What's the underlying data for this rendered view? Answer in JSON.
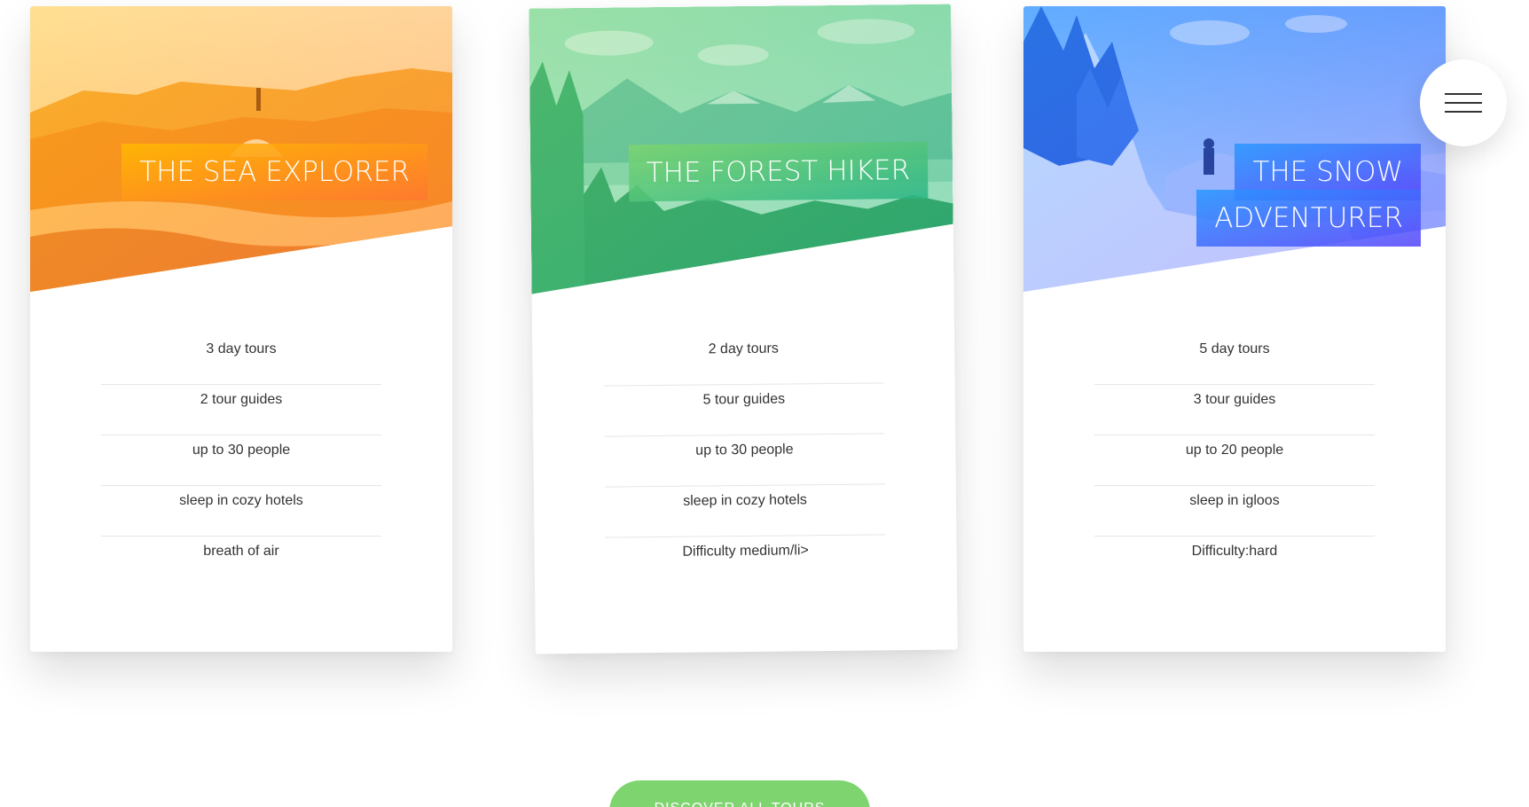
{
  "menu": {
    "icon": "hamburger-icon"
  },
  "cards": [
    {
      "title": "THE SEA EXPLORER",
      "theme_colors": [
        "#ffb900",
        "#ff7730"
      ],
      "image": "rocky-coast-photo",
      "features": [
        "3 day tours",
        "2 tour guides",
        "up to 30 people",
        "sleep in cozy hotels",
        "breath of air"
      ]
    },
    {
      "title": "THE FOREST HIKER",
      "theme_colors": [
        "#7ed56f",
        "#28b485"
      ],
      "image": "forest-mountains-photo",
      "features": [
        "2 day tours",
        "5 tour guides",
        "up to 30 people",
        "sleep in cozy hotels",
        "Difficulty medium/li>"
      ]
    },
    {
      "title_line1": "THE SNOW",
      "title_line2": "ADVENTURER",
      "theme_colors": [
        "#2998ff",
        "#5643fa"
      ],
      "image": "snowy-mountain-photo",
      "features": [
        "5 day tours",
        "3 tour guides",
        "up to 20 people",
        "sleep in igloos",
        "Difficulty:hard"
      ]
    }
  ],
  "cta": {
    "label": "DISCOVER ALL TOURS",
    "color": "#7ed56f"
  }
}
